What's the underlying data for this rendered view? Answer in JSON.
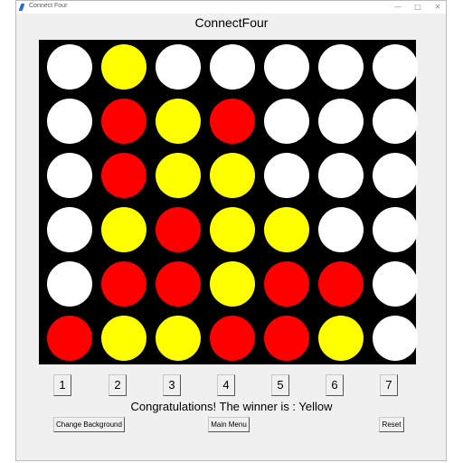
{
  "window": {
    "title": "Connect Four",
    "controls": {
      "minimize": "—",
      "maximize": "□",
      "close": "✕"
    }
  },
  "app_title": "ConnectFour",
  "colors": {
    "red": "#ff0000",
    "yellow": "#ffff00",
    "empty": "#ffffff",
    "board": "#000000"
  },
  "board": [
    [
      "W",
      "Y",
      "W",
      "W",
      "W",
      "W",
      "W"
    ],
    [
      "W",
      "R",
      "Y",
      "R",
      "W",
      "W",
      "W"
    ],
    [
      "W",
      "R",
      "Y",
      "Y",
      "W",
      "W",
      "W"
    ],
    [
      "W",
      "Y",
      "R",
      "Y",
      "Y",
      "W",
      "W"
    ],
    [
      "W",
      "R",
      "R",
      "Y",
      "R",
      "R",
      "W"
    ],
    [
      "R",
      "Y",
      "Y",
      "R",
      "R",
      "Y",
      "W"
    ]
  ],
  "column_buttons": [
    "1",
    "2",
    "3",
    "4",
    "5",
    "6",
    "7"
  ],
  "status": "Congratulations! The winner is : Yellow",
  "buttons": {
    "change_background": "Change Background",
    "main_menu": "Main Menu",
    "reset": "Reset"
  }
}
